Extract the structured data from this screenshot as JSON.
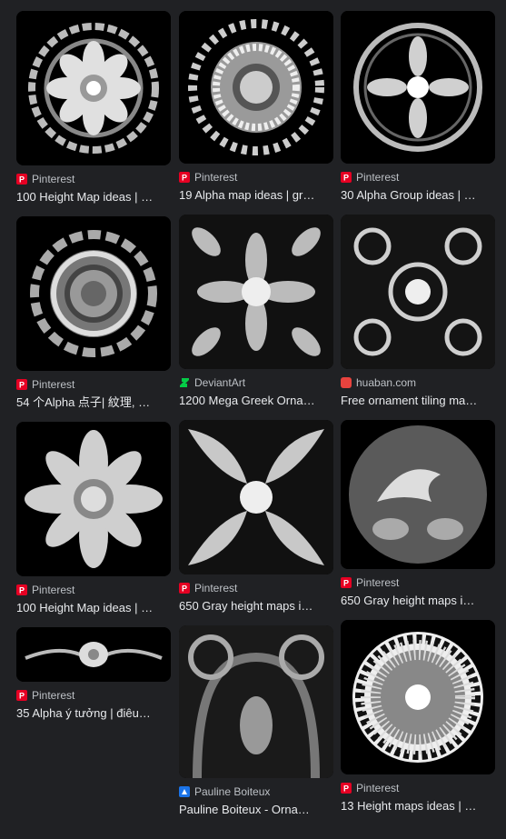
{
  "results": [
    {
      "source": "Pinterest",
      "source_icon": "pinterest-icon",
      "title": "100 Height Map ideas | …"
    },
    {
      "source": "Pinterest",
      "source_icon": "pinterest-icon",
      "title": "19 Alpha map ideas | gr…"
    },
    {
      "source": "Pinterest",
      "source_icon": "pinterest-icon",
      "title": "30 Alpha Group ideas | …"
    },
    {
      "source": "Pinterest",
      "source_icon": "pinterest-icon",
      "title": "54 个Alpha 点子| 紋理, …"
    },
    {
      "source": "DeviantArt",
      "source_icon": "deviantart-icon",
      "title": "1200 Mega Greek Orna…"
    },
    {
      "source": "huaban.com",
      "source_icon": "huaban-icon",
      "title": "Free ornament tiling ma…"
    },
    {
      "source": "Pinterest",
      "source_icon": "pinterest-icon",
      "title": "100 Height Map ideas | …"
    },
    {
      "source": "Pinterest",
      "source_icon": "pinterest-icon",
      "title": "650 Gray height maps i…"
    },
    {
      "source": "Pinterest",
      "source_icon": "pinterest-icon",
      "title": "650 Gray height maps i…"
    },
    {
      "source": "Pinterest",
      "source_icon": "pinterest-icon",
      "title": "35 Alpha ý tưởng | điêu…"
    },
    {
      "source": "Pauline Boiteux",
      "source_icon": "pauline-boiteux-icon",
      "title": "Pauline Boiteux - Orna…"
    },
    {
      "source": "Pinterest",
      "source_icon": "pinterest-icon",
      "title": "13 Height maps ideas | …"
    }
  ],
  "colors": {
    "background": "#202124",
    "pinterest": "#e60023",
    "deviantart": "#05cc47",
    "huaban": "#e8433e",
    "text": "#e8eaed",
    "source_text": "#bdc1c6"
  }
}
